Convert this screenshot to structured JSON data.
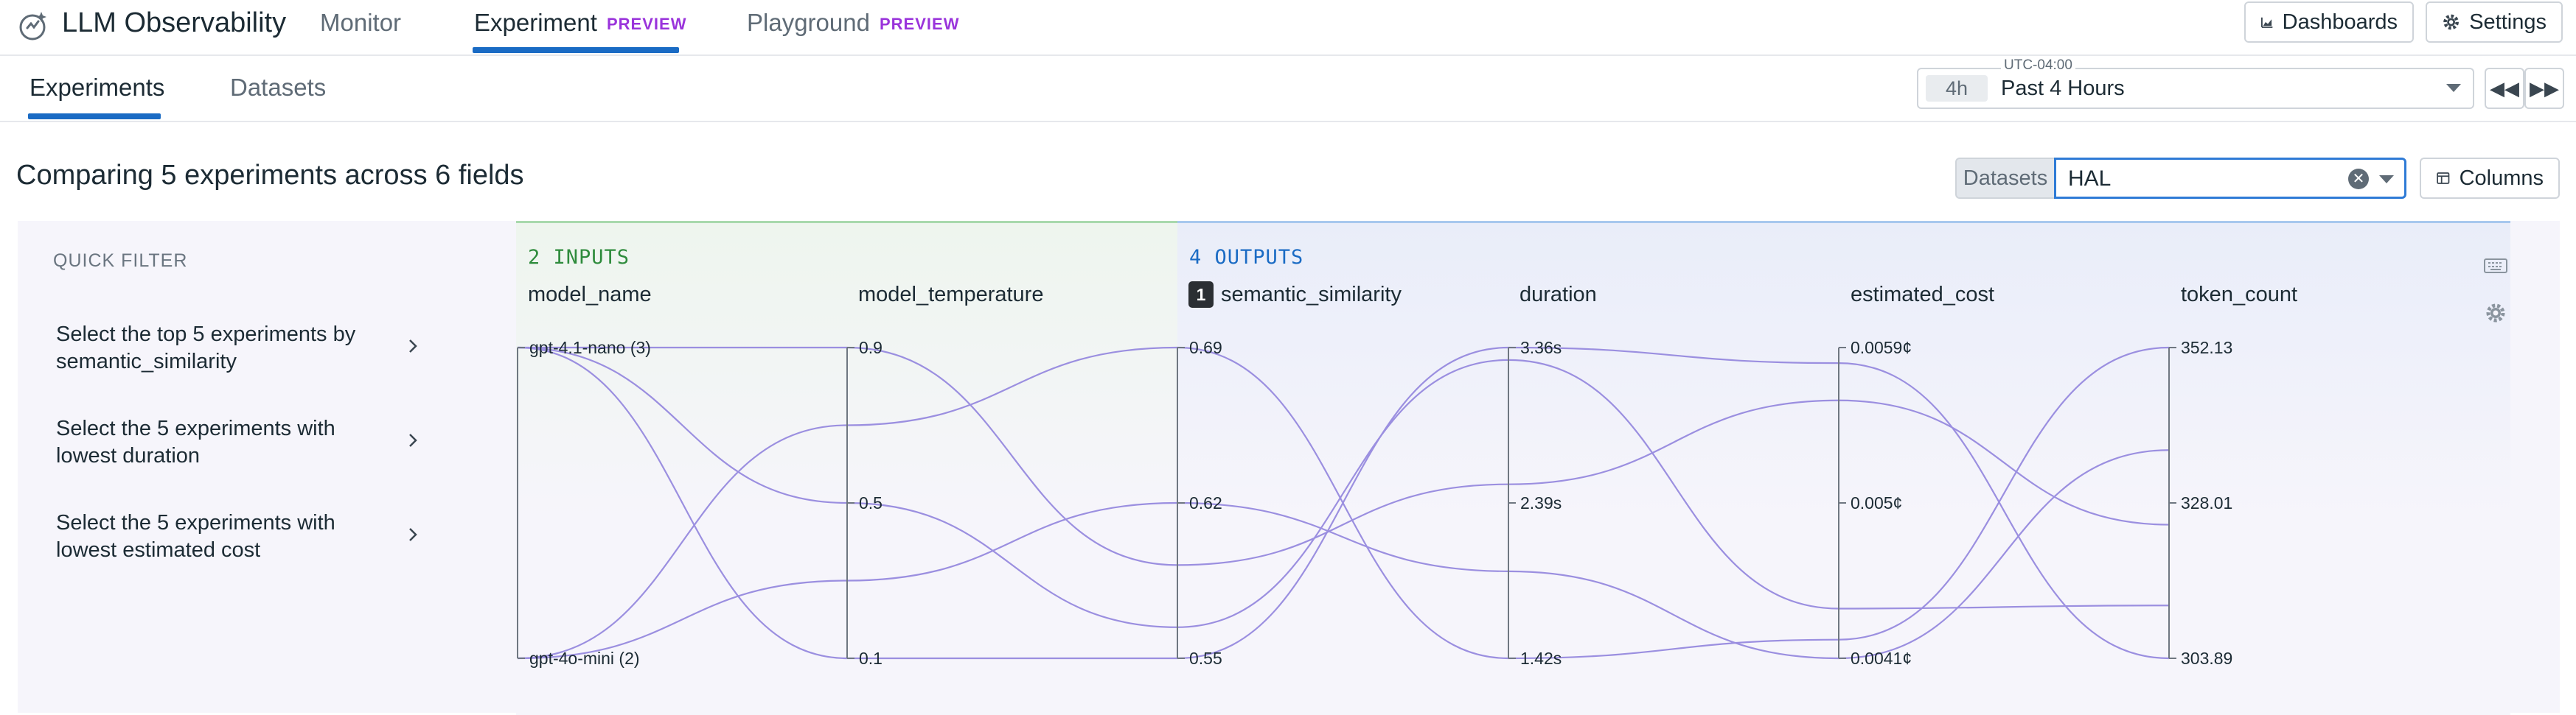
{
  "app": {
    "title": "LLM Observability",
    "nav": [
      {
        "label": "Monitor",
        "badge": "",
        "active": false
      },
      {
        "label": "Experiment",
        "badge": "PREVIEW",
        "active": true
      },
      {
        "label": "Playground",
        "badge": "PREVIEW",
        "active": false
      }
    ],
    "actions": {
      "dashboards": "Dashboards",
      "settings": "Settings"
    }
  },
  "subnav": {
    "tabs": [
      {
        "label": "Experiments",
        "active": true
      },
      {
        "label": "Datasets",
        "active": false
      }
    ]
  },
  "time": {
    "timezone": "UTC-04:00",
    "chip": "4h",
    "range": "Past 4 Hours"
  },
  "header": {
    "title": "Comparing 5 experiments across 6 fields",
    "dataset_label": "Datasets",
    "dataset_value": "HAL",
    "columns_label": "Columns"
  },
  "quick_filter": {
    "title": "QUICK FILTER",
    "items": [
      {
        "line1": "Select the top 5 experiments by",
        "line2": "semantic_similarity"
      },
      {
        "line1": "Select the 5 experiments with",
        "line2": "lowest duration"
      },
      {
        "line1": "Select the 5 experiments with",
        "line2": "lowest estimated cost"
      }
    ]
  },
  "chart_data": {
    "type": "parallel_coordinates",
    "groups": [
      {
        "label": "2 INPUTS",
        "color": "#2e8b3c"
      },
      {
        "label": "4 OUTPUTS",
        "color": "#1a6bc4"
      }
    ],
    "axes": [
      {
        "name": "model_name",
        "badge": "",
        "ticks": [
          "gpt-4.1-nano (3)",
          "gpt-4o-mini (2)"
        ]
      },
      {
        "name": "model_temperature",
        "badge": "",
        "ticks": [
          "0.9",
          "0.5",
          "0.1"
        ]
      },
      {
        "name": "semantic_similarity",
        "badge": "1",
        "ticks": [
          "0.69",
          "0.62",
          "0.55"
        ]
      },
      {
        "name": "duration",
        "badge": "",
        "ticks": [
          "3.36s",
          "2.39s",
          "1.42s"
        ]
      },
      {
        "name": "estimated_cost",
        "badge": "",
        "ticks": [
          "0.0059¢",
          "0.005¢",
          "0.0041¢"
        ]
      },
      {
        "name": "token_count",
        "badge": "",
        "ticks": [
          "352.13",
          "328.01",
          "303.89"
        ]
      }
    ],
    "line_color": "#9b8fe0",
    "experiments": [
      {
        "values": [
          1.0,
          1.0,
          0.3,
          0.56,
          0.83,
          0.43
        ]
      },
      {
        "values": [
          1.0,
          0.5,
          0.1,
          0.96,
          0.16,
          0.17
        ]
      },
      {
        "values": [
          1.0,
          0.0,
          0.0,
          1.0,
          0.95,
          0.0
        ]
      },
      {
        "values": [
          0.0,
          0.75,
          1.0,
          0.0,
          0.06,
          1.0
        ]
      },
      {
        "values": [
          0.0,
          0.25,
          0.5,
          0.28,
          0.0,
          0.67
        ]
      }
    ]
  }
}
